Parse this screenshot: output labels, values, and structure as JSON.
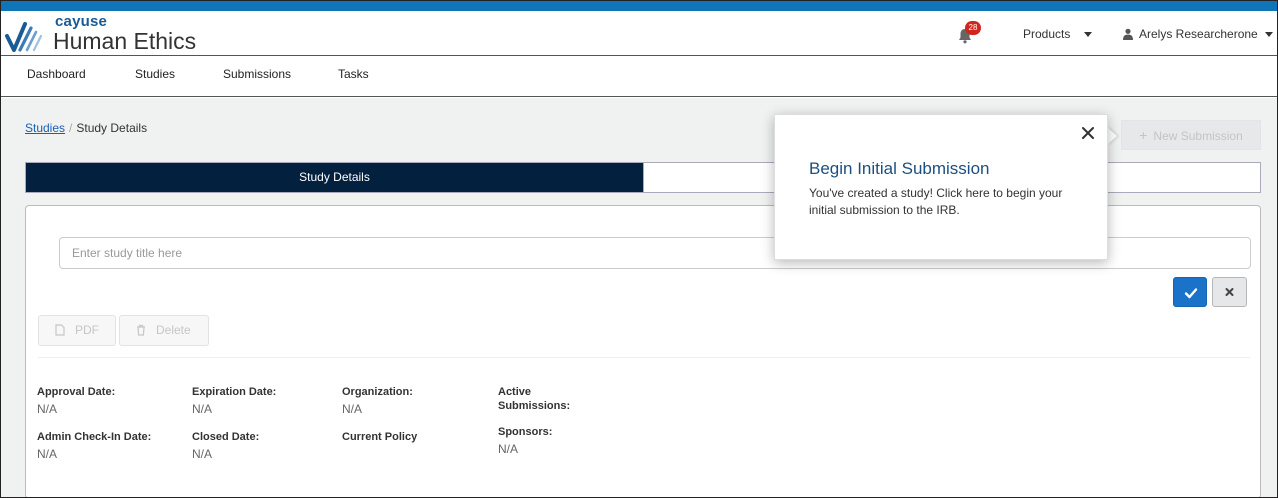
{
  "brand": {
    "company": "cayuse",
    "product": "Human Ethics"
  },
  "header": {
    "notifications_count": "28",
    "products_label": "Products",
    "user_name": "Arelys Researcherone"
  },
  "nav": {
    "items": [
      "Dashboard",
      "Studies",
      "Submissions",
      "Tasks"
    ]
  },
  "breadcrumb": {
    "parent": "Studies",
    "separator": "/",
    "current": "Study Details"
  },
  "actions": {
    "new_submission": "New Submission"
  },
  "tabs": {
    "active": "Study Details"
  },
  "study": {
    "title_placeholder": "Enter study title here",
    "pdf_label": "PDF",
    "delete_label": "Delete"
  },
  "fields": {
    "approval_date": {
      "label": "Approval Date:",
      "value": "N/A"
    },
    "expiration_date": {
      "label": "Expiration Date:",
      "value": "N/A"
    },
    "organization": {
      "label": "Organization:",
      "value": "N/A"
    },
    "active_submissions": {
      "label_line1": "Active",
      "label_line2": "Submissions:"
    },
    "admin_checkin_date": {
      "label": "Admin Check-In Date:",
      "value": "N/A"
    },
    "closed_date": {
      "label": "Closed Date:",
      "value": "N/A"
    },
    "current_policy": {
      "label": "Current Policy"
    },
    "sponsors": {
      "label": "Sponsors:",
      "value": "N/A"
    }
  },
  "popover": {
    "title": "Begin Initial Submission",
    "body": "You've created a study! Click here to begin your initial submission to the IRB."
  },
  "colors": {
    "topbar": "#0f74b8",
    "tab_active_bg": "#03203f",
    "primary_button": "#1a73c9",
    "popover_title": "#1c4f82",
    "badge": "#d0261d"
  }
}
